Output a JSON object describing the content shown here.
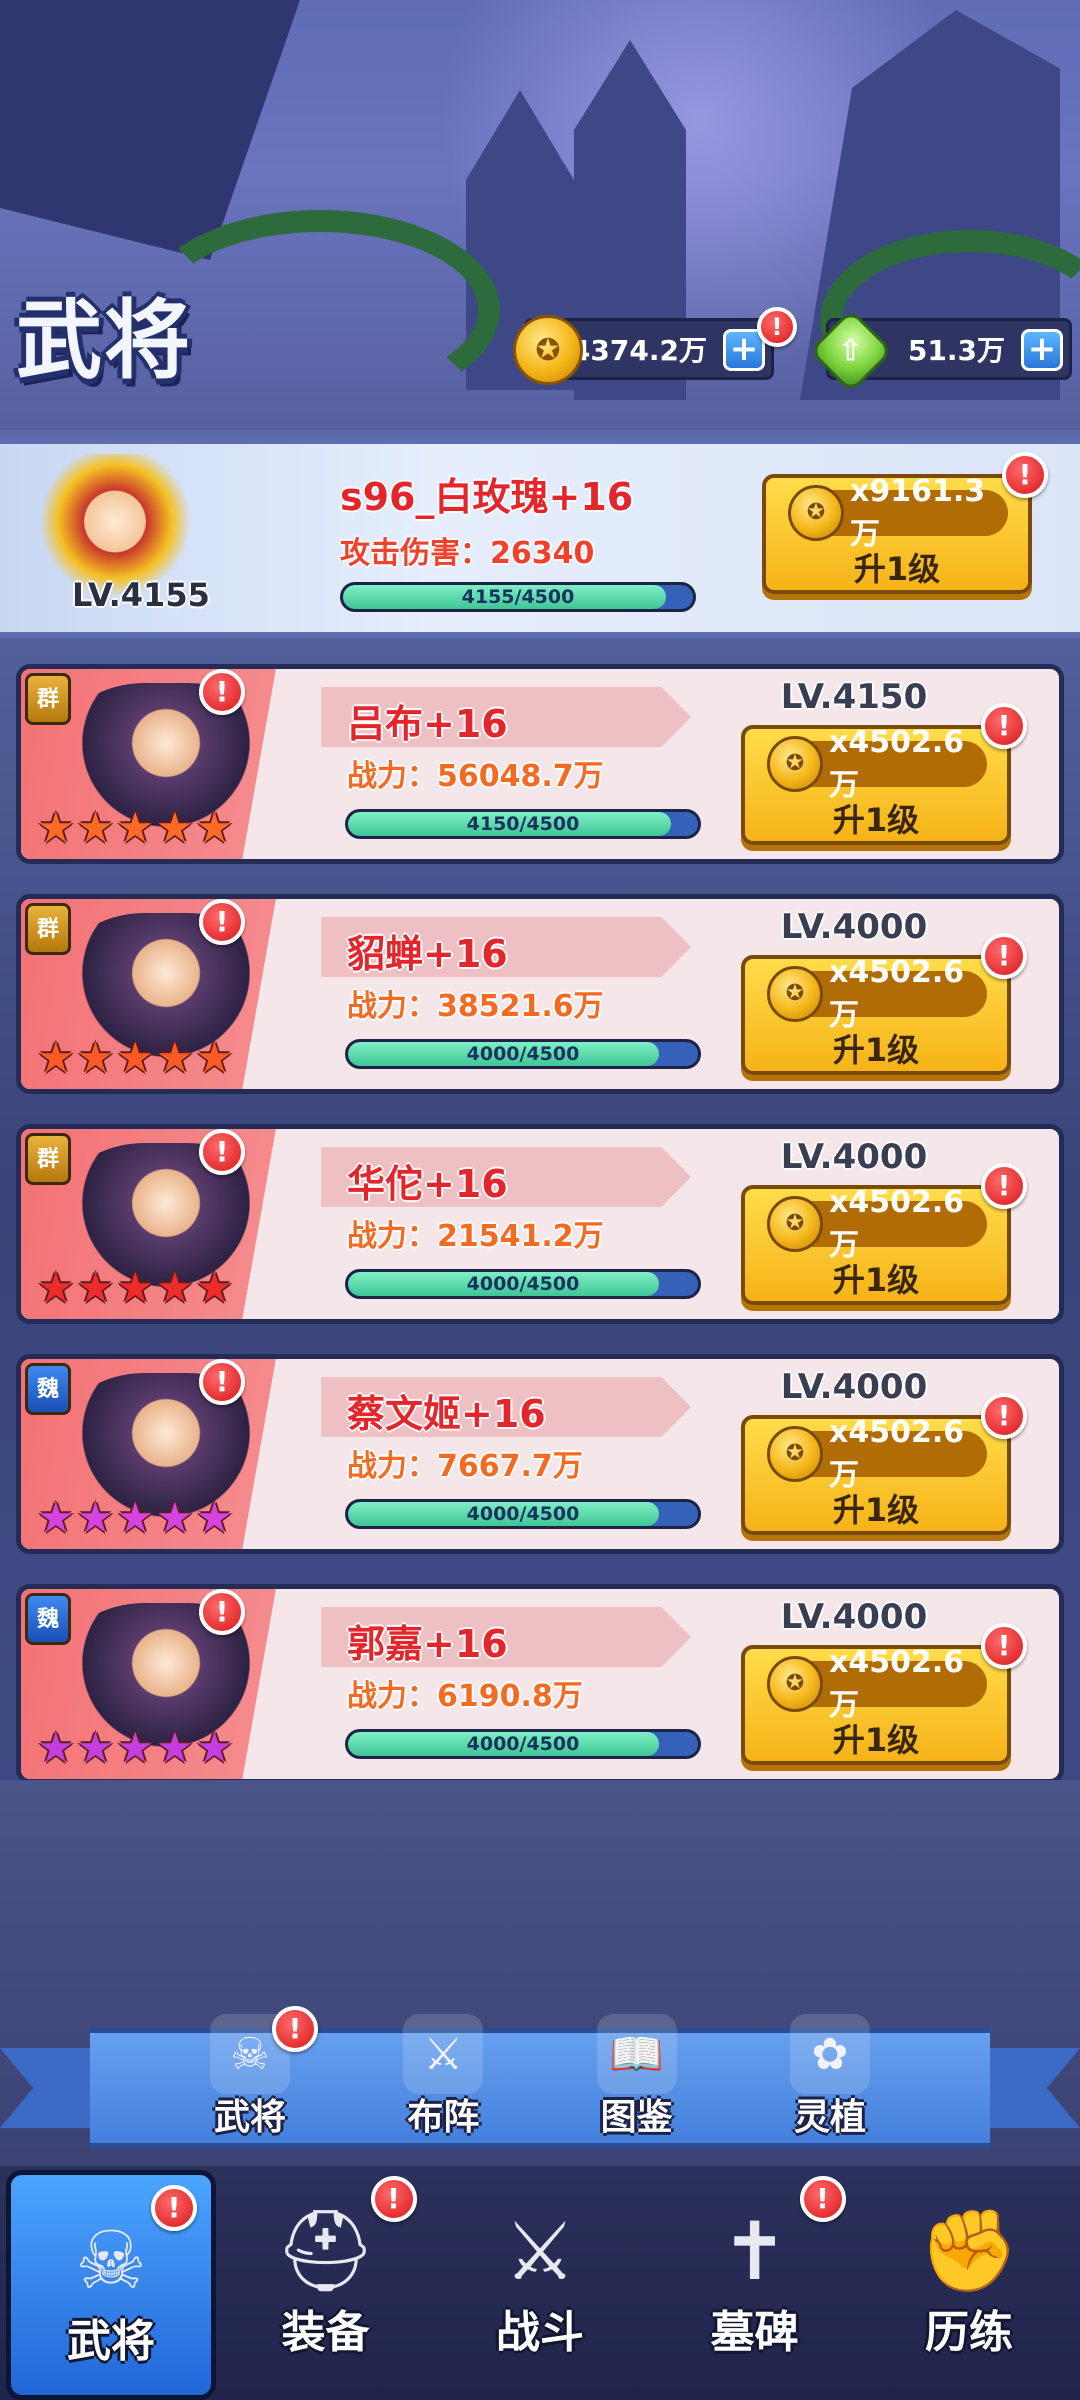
{
  "header": {
    "title": "武将",
    "gold": "14374.2万",
    "gems": "51.3万"
  },
  "featured": {
    "name": "s96_白玫瑰+16",
    "stat": "攻击伤害：26340",
    "progress_text": "4155/4500",
    "progress": 0.923,
    "level": "LV.4155",
    "cost": "x9161.3万",
    "button": "升1级"
  },
  "heroes": [
    {
      "faction": "群",
      "name": "吕布+16",
      "power": "战力：56048.7万",
      "progress_text": "4150/4500",
      "progress": 0.922,
      "level": "LV.4150",
      "cost": "x4502.6万",
      "button": "升1级",
      "star_color": "#ff6a26"
    },
    {
      "faction": "群",
      "name": "貂蝉+16",
      "power": "战力：38521.6万",
      "progress_text": "4000/4500",
      "progress": 0.889,
      "level": "LV.4000",
      "cost": "x4502.6万",
      "button": "升1级",
      "star_color": "#ff5a26"
    },
    {
      "faction": "群",
      "name": "华佗+16",
      "power": "战力：21541.2万",
      "progress_text": "4000/4500",
      "progress": 0.889,
      "level": "LV.4000",
      "cost": "x4502.6万",
      "button": "升1级",
      "star_color": "#ef2b2b"
    },
    {
      "faction": "魏",
      "name": "蔡文姬+16",
      "power": "战力：7667.7万",
      "progress_text": "4000/4500",
      "progress": 0.889,
      "level": "LV.4000",
      "cost": "x4502.6万",
      "button": "升1级",
      "star_color": "#d743e0"
    },
    {
      "faction": "魏",
      "name": "郭嘉+16",
      "power": "战力：6190.8万",
      "progress_text": "4000/4500",
      "progress": 0.889,
      "level": "LV.4000",
      "cost": "x4502.6万",
      "button": "升1级",
      "star_color": "#c43ee0"
    }
  ],
  "subnav": [
    {
      "label": "武将",
      "icon": "skull-tombstone-icon",
      "alert": true
    },
    {
      "label": "布阵",
      "icon": "crossed-swords-icon",
      "alert": false
    },
    {
      "label": "图鉴",
      "icon": "open-book-icon",
      "alert": false
    },
    {
      "label": "灵植",
      "icon": "purple-plant-icon",
      "alert": false
    }
  ],
  "bottom_nav": [
    {
      "label": "武将",
      "icon": "skull-icon",
      "active": true,
      "alert": true
    },
    {
      "label": "装备",
      "icon": "helmet-icon",
      "active": false,
      "alert": true
    },
    {
      "label": "战斗",
      "icon": "crossed-swords-icon",
      "active": false,
      "alert": false
    },
    {
      "label": "墓碑",
      "icon": "tombstone-icon",
      "active": false,
      "alert": true
    },
    {
      "label": "历练",
      "icon": "fist-icon",
      "active": false,
      "alert": false
    }
  ]
}
